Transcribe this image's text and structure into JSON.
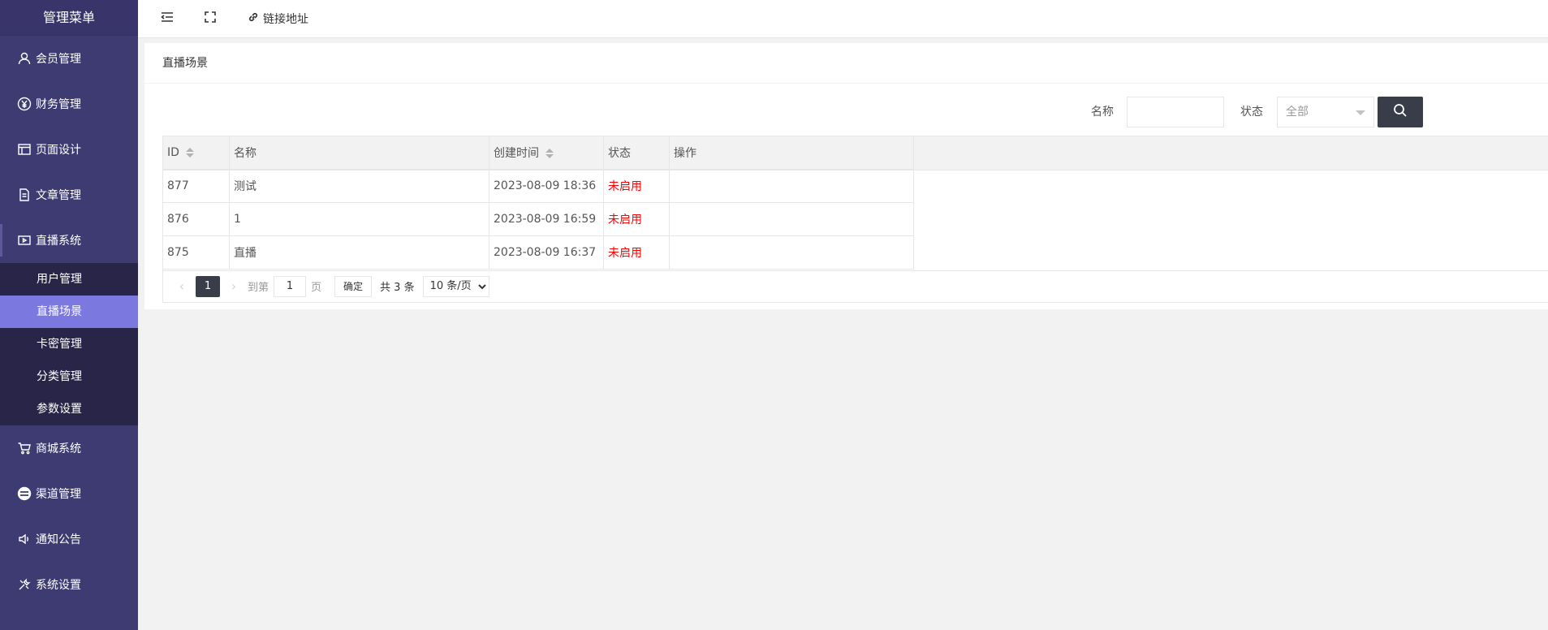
{
  "sidebar": {
    "title": "管理菜单",
    "items": [
      {
        "label": "会员管理",
        "icon": "user-icon"
      },
      {
        "label": "财务管理",
        "icon": "yen-icon"
      },
      {
        "label": "页面设计",
        "icon": "layout-icon"
      },
      {
        "label": "文章管理",
        "icon": "document-icon"
      },
      {
        "label": "直播系统",
        "icon": "video-icon"
      },
      {
        "label": "商城系统",
        "icon": "cart-icon"
      },
      {
        "label": "渠道管理",
        "icon": "channel-icon"
      },
      {
        "label": "通知公告",
        "icon": "speaker-icon"
      },
      {
        "label": "系统设置",
        "icon": "tools-icon"
      }
    ],
    "submenu": [
      {
        "label": "用户管理"
      },
      {
        "label": "直播场景"
      },
      {
        "label": "卡密管理"
      },
      {
        "label": "分类管理"
      },
      {
        "label": "参数设置"
      }
    ]
  },
  "topbar": {
    "link_label": "链接地址"
  },
  "card": {
    "title": "直播场景"
  },
  "search": {
    "name_label": "名称",
    "name_value": "",
    "status_label": "状态",
    "status_selected": "全部"
  },
  "table": {
    "headers": [
      "ID",
      "名称",
      "创建时间",
      "状态",
      "操作"
    ],
    "rows": [
      {
        "id": "877",
        "name": "测试",
        "created": "2023-08-09 18:36",
        "status": "未启用",
        "action": ""
      },
      {
        "id": "876",
        "name": "1",
        "created": "2023-08-09 16:59",
        "status": "未启用",
        "action": ""
      },
      {
        "id": "875",
        "name": "直播",
        "created": "2023-08-09 16:37",
        "status": "未启用",
        "action": ""
      }
    ]
  },
  "pager": {
    "current_page": "1",
    "goto_label": "到第",
    "goto_value": "1",
    "page_suffix": "页",
    "confirm_label": "确定",
    "total_label": "共 3 条",
    "page_size": "10 条/页"
  },
  "colors": {
    "sidebar_bg": "#3e3b72",
    "submenu_bg": "#292548",
    "active_item": "#7b78e0",
    "status_red": "#ff0000",
    "dark_button": "#393d49"
  }
}
